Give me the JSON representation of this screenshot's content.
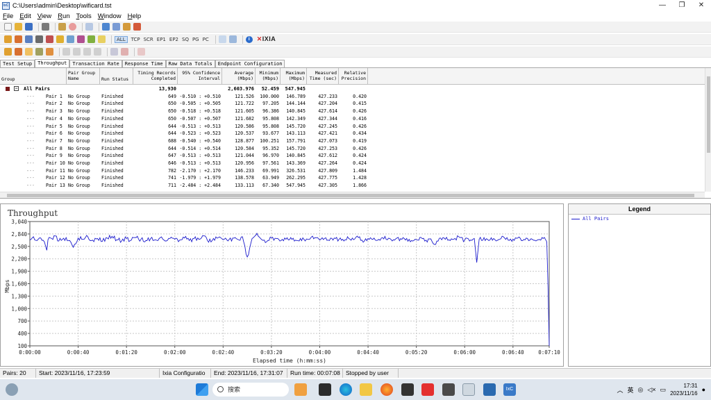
{
  "window": {
    "title": "C:\\Users\\admin\\Desktop\\wificard.tst",
    "app_icon": "IxC",
    "buttons": [
      "—",
      "❐",
      "✕"
    ]
  },
  "menu": [
    "File",
    "Edit",
    "View",
    "Run",
    "Tools",
    "Window",
    "Help"
  ],
  "protocol_filters": [
    "ALL",
    "TCP",
    "SCR",
    "EP1",
    "EP2",
    "SQ",
    "PG",
    "PC"
  ],
  "toolbar": {
    "brand": "IXIA"
  },
  "tabs": [
    "Test Setup",
    "Throughput",
    "Transaction Rate",
    "Response Time",
    "Raw Data Totals",
    "Endpoint Configuration"
  ],
  "active_tab": 1,
  "grid": {
    "headers": {
      "group": "Group",
      "pair_group": "Pair Group Name",
      "run_status": "Run Status",
      "timing": "Timing Records Completed",
      "conf": "95% Confidence Interval",
      "avg": "Average (Mbps)",
      "min": "Minimum (Mbps)",
      "max": "Maximum (Mbps)",
      "time": "Measured Time (sec)",
      "prec": "Relative Precision"
    },
    "all": {
      "label": "All Pairs",
      "records": "13,930",
      "avg": "2,603.976",
      "min": "52.459",
      "max": "547.945"
    },
    "rows": [
      {
        "pair": "Pair 1",
        "group": "No Group",
        "status": "Finished",
        "rec": "649",
        "ci": "-0.510 : +0.510",
        "avg": "121.526",
        "min": "100.000",
        "max": "146.789",
        "time": "427.233",
        "prec": "0.420"
      },
      {
        "pair": "Pair 2",
        "group": "No Group",
        "status": "Finished",
        "rec": "650",
        "ci": "-0.505 : +0.505",
        "avg": "121.722",
        "min": "97.205",
        "max": "144.144",
        "time": "427.204",
        "prec": "0.415"
      },
      {
        "pair": "Pair 3",
        "group": "No Group",
        "status": "Finished",
        "rec": "650",
        "ci": "-0.518 : +0.518",
        "avg": "121.605",
        "min": "96.386",
        "max": "140.845",
        "time": "427.614",
        "prec": "0.426"
      },
      {
        "pair": "Pair 4",
        "group": "No Group",
        "status": "Finished",
        "rec": "650",
        "ci": "-0.507 : +0.507",
        "avg": "121.682",
        "min": "95.808",
        "max": "142.349",
        "time": "427.344",
        "prec": "0.416"
      },
      {
        "pair": "Pair 5",
        "group": "No Group",
        "status": "Finished",
        "rec": "644",
        "ci": "-0.513 : +0.513",
        "avg": "120.586",
        "min": "95.808",
        "max": "145.720",
        "time": "427.245",
        "prec": "0.426"
      },
      {
        "pair": "Pair 6",
        "group": "No Group",
        "status": "Finished",
        "rec": "644",
        "ci": "-0.523 : +0.523",
        "avg": "120.537",
        "min": "93.677",
        "max": "143.113",
        "time": "427.421",
        "prec": "0.434"
      },
      {
        "pair": "Pair 7",
        "group": "No Group",
        "status": "Finished",
        "rec": "688",
        "ci": "-0.540 : +0.540",
        "avg": "128.877",
        "min": "100.251",
        "max": "157.791",
        "time": "427.073",
        "prec": "0.419"
      },
      {
        "pair": "Pair 8",
        "group": "No Group",
        "status": "Finished",
        "rec": "644",
        "ci": "-0.514 : +0.514",
        "avg": "120.584",
        "min": "95.352",
        "max": "145.720",
        "time": "427.253",
        "prec": "0.426"
      },
      {
        "pair": "Pair 9",
        "group": "No Group",
        "status": "Finished",
        "rec": "647",
        "ci": "-0.513 : +0.513",
        "avg": "121.044",
        "min": "96.970",
        "max": "140.845",
        "time": "427.612",
        "prec": "0.424"
      },
      {
        "pair": "Pair 10",
        "group": "No Group",
        "status": "Finished",
        "rec": "646",
        "ci": "-0.513 : +0.513",
        "avg": "120.956",
        "min": "97.561",
        "max": "143.369",
        "time": "427.264",
        "prec": "0.424"
      },
      {
        "pair": "Pair 11",
        "group": "No Group",
        "status": "Finished",
        "rec": "782",
        "ci": "-2.170 : +2.170",
        "avg": "146.233",
        "min": "69.991",
        "max": "326.531",
        "time": "427.809",
        "prec": "1.484"
      },
      {
        "pair": "Pair 12",
        "group": "No Group",
        "status": "Finished",
        "rec": "741",
        "ci": "-1.979 : +1.979",
        "avg": "138.578",
        "min": "63.949",
        "max": "262.295",
        "time": "427.775",
        "prec": "1.428"
      },
      {
        "pair": "Pair 13",
        "group": "No Group",
        "status": "Finished",
        "rec": "711",
        "ci": "-2.484 : +2.484",
        "avg": "133.113",
        "min": "67.340",
        "max": "547.945",
        "time": "427.305",
        "prec": "1.866"
      }
    ]
  },
  "chart_data": {
    "type": "line",
    "title": "Throughput",
    "xlabel": "Elapsed time (h:mm:ss)",
    "ylabel": "Mbps",
    "xticks": [
      "0:00:00",
      "0:00:40",
      "0:01:20",
      "0:02:00",
      "0:02:40",
      "0:03:20",
      "0:04:00",
      "0:04:40",
      "0:05:20",
      "0:06:00",
      "0:06:40",
      "0:07:10"
    ],
    "xlim_seconds": [
      0,
      430
    ],
    "yticks": [
      "3,040",
      "2,840",
      "2,500",
      "2,200",
      "1,900",
      "1,600",
      "1,300",
      "1,000",
      "700",
      "400",
      "100"
    ],
    "ylim": [
      100,
      3040
    ],
    "grid": true,
    "series": [
      {
        "name": "All Pairs",
        "color": "#1a1acc",
        "x": [
          0,
          3,
          6,
          9,
          12,
          14,
          15,
          18,
          21,
          24,
          27,
          30,
          33,
          36,
          40,
          44,
          48,
          52,
          56,
          60,
          64,
          68,
          72,
          76,
          80,
          84,
          88,
          92,
          96,
          100,
          104,
          108,
          112,
          116,
          120,
          124,
          128,
          132,
          136,
          140,
          144,
          148,
          152,
          156,
          160,
          164,
          168,
          172,
          176,
          180,
          184,
          188,
          192,
          196,
          200,
          204,
          208,
          212,
          216,
          220,
          224,
          228,
          232,
          236,
          240,
          244,
          248,
          252,
          256,
          260,
          264,
          268,
          272,
          276,
          280,
          284,
          288,
          292,
          296,
          300,
          304,
          308,
          312,
          316,
          320,
          324,
          328,
          332,
          336,
          340,
          344,
          348,
          352,
          356,
          360,
          364,
          368,
          370,
          372,
          376,
          380,
          384,
          388,
          392,
          396,
          400,
          404,
          408,
          412,
          416,
          420,
          424,
          427,
          428,
          429,
          430
        ],
        "y": [
          2600,
          2680,
          2590,
          2650,
          2560,
          2360,
          2610,
          2640,
          2700,
          2580,
          2620,
          2660,
          2590,
          2430,
          2650,
          2620,
          2680,
          2600,
          2640,
          2570,
          2650,
          2690,
          2610,
          2580,
          2640,
          2600,
          2660,
          2620,
          2590,
          2640,
          2610,
          2660,
          2580,
          2640,
          2620,
          2600,
          2650,
          2590,
          2640,
          2620,
          2700,
          2550,
          2640,
          2660,
          2610,
          2580,
          2650,
          2620,
          2680,
          2200,
          2640,
          2760,
          2610,
          2560,
          2650,
          2640,
          2590,
          2620,
          2660,
          2600,
          2640,
          2580,
          2630,
          2660,
          2600,
          2640,
          2590,
          2650,
          2620,
          2580,
          2640,
          2610,
          2660,
          2550,
          2640,
          2620,
          2600,
          2660,
          2610,
          2580,
          2650,
          2620,
          2640,
          2590,
          2610,
          2660,
          2600,
          2630,
          2500,
          2650,
          2620,
          2590,
          2640,
          2660,
          2600,
          2580,
          2640,
          2070,
          2620,
          2660,
          2590,
          2640,
          2610,
          2680,
          2600,
          2620,
          2650,
          2590,
          2640,
          2620,
          2600,
          2660,
          2610,
          2560,
          1500,
          100
        ]
      }
    ]
  },
  "legend": {
    "title": "Legend",
    "items": [
      "All Pairs"
    ]
  },
  "status": {
    "pairs": "Pairs: 20",
    "start": "Start: 2023/11/16, 17:23:59",
    "config": "Ixia Configuratio",
    "end": "End: 2023/11/16, 17:31:07",
    "runtime": "Run time: 00:07:08",
    "stopped": "Stopped by user"
  },
  "taskbar": {
    "search": "搜索",
    "ime": "英",
    "time": "17:31",
    "date": "2023/11/16",
    "apps": [
      "start-icon",
      "search",
      "people-icon",
      "edge-icon",
      "explorer-icon",
      "firefox-icon",
      "terminal-icon",
      "wps-icon",
      "snip-icon",
      "chart-icon",
      "ixchariot-icon",
      "ixc-app-icon"
    ]
  }
}
